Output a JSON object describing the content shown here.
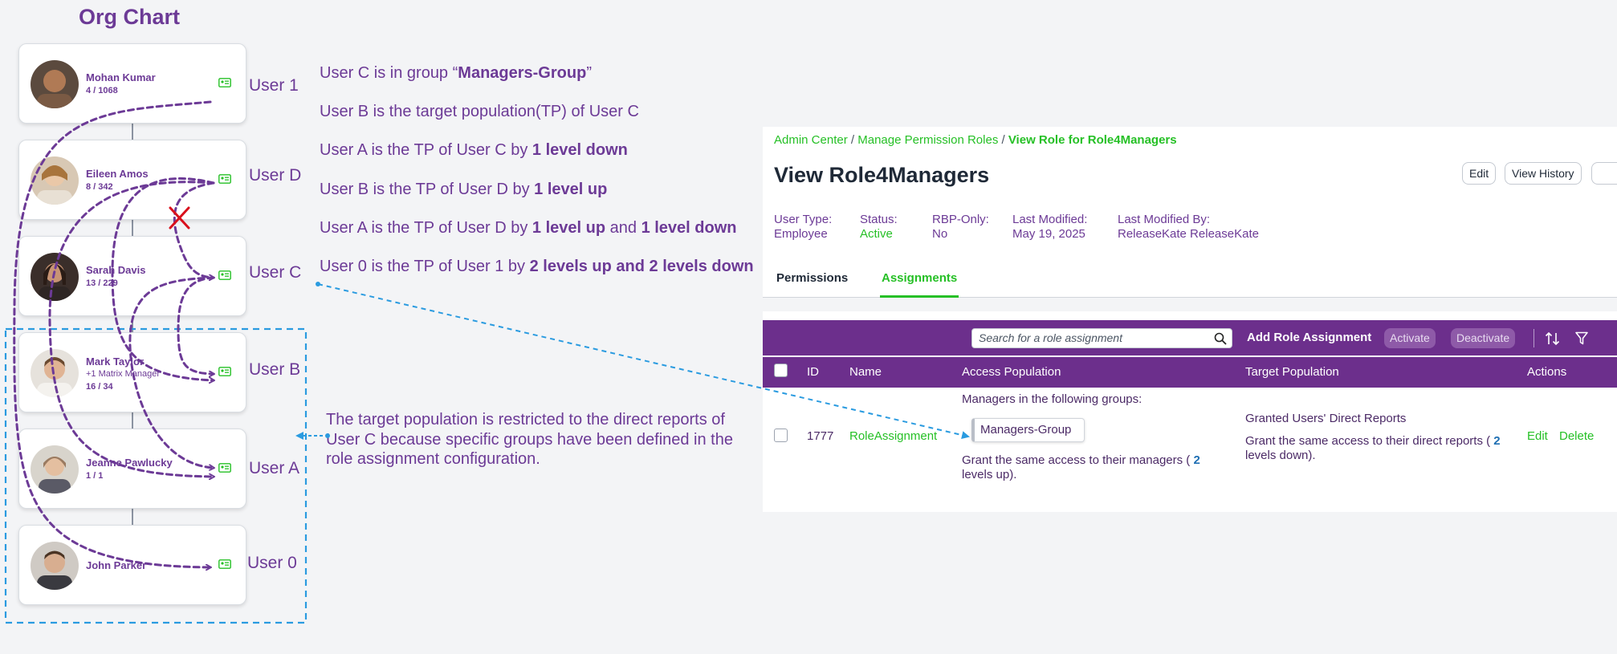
{
  "org_chart": {
    "title": "Org Chart",
    "cards": [
      {
        "name": "Mohan Kumar",
        "sub": "",
        "count": "4 / 1068",
        "user_label": "User 1"
      },
      {
        "name": "Eileen Amos",
        "sub": "",
        "count": "8 / 342",
        "user_label": "User D"
      },
      {
        "name": "Sarah Davis",
        "sub": "",
        "count": "13 / 229",
        "user_label": "User C"
      },
      {
        "name": "Mark Taylor",
        "sub": "+1 Matrix Manager",
        "count": "16 / 34",
        "user_label": "User B"
      },
      {
        "name": "Jeanne Pawlucky",
        "sub": "",
        "count": "1 / 1",
        "user_label": "User A"
      },
      {
        "name": "John Parker",
        "sub": "",
        "count": "",
        "user_label": "User 0"
      }
    ]
  },
  "statements": [
    {
      "parts": [
        {
          "t": "User C is in group “",
          "b": false
        },
        {
          "t": "Managers-Group",
          "b": true
        },
        {
          "t": "”",
          "b": false
        }
      ]
    },
    {
      "parts": [
        {
          "t": "User B is the target population(TP) of User C",
          "b": false
        }
      ]
    },
    {
      "parts": [
        {
          "t": "User A is the TP of User C by ",
          "b": false
        },
        {
          "t": "1 level down",
          "b": true
        }
      ]
    },
    {
      "parts": [
        {
          "t": "User B is the TP of User D by ",
          "b": false
        },
        {
          "t": "1 level up",
          "b": true
        }
      ]
    },
    {
      "parts": [
        {
          "t": "User A is the TP of User D by ",
          "b": false
        },
        {
          "t": "1 level up",
          "b": true
        },
        {
          "t": " and ",
          "b": false
        },
        {
          "t": "1 level down",
          "b": true
        }
      ]
    },
    {
      "parts": [
        {
          "t": "User 0 is the TP of User 1 by ",
          "b": false
        },
        {
          "t": "2 levels up and 2 levels down",
          "b": true
        }
      ]
    }
  ],
  "note": "The target population is restricted to the direct reports of User C because specific groups have been defined in the role assignment configuration.",
  "panel": {
    "breadcrumb": {
      "item1": "Admin Center",
      "item2": "Manage Permission Roles",
      "current": "View Role for Role4Managers",
      "sep": "/"
    },
    "title": "View Role4Managers",
    "buttons": {
      "edit": "Edit",
      "history": "View History"
    },
    "meta": [
      {
        "k": "User Type:",
        "v": "Employee"
      },
      {
        "k": "Status:",
        "v": "Active"
      },
      {
        "k": "RBP-Only:",
        "v": "No"
      },
      {
        "k": "Last Modified:",
        "v": "May 19, 2025"
      },
      {
        "k": "Last Modified By:",
        "v": "ReleaseKate ReleaseKate"
      }
    ],
    "tabs": {
      "permissions": "Permissions",
      "assignments": "Assignments"
    },
    "toolbar": {
      "search_placeholder": "Search for a role assignment",
      "add": "Add Role Assignment",
      "activate": "Activate",
      "deactivate": "Deactivate"
    },
    "columns": {
      "id": "ID",
      "name": "Name",
      "access": "Access Population",
      "target": "Target Population",
      "actions": "Actions"
    },
    "row": {
      "id": "1777",
      "name": "RoleAssignment",
      "access_heading": "Managers in the following groups:",
      "group_chip": "Managers-Group",
      "access_line1": "Grant the same access to their managers ( ",
      "access_num": "2",
      "access_line2": "levels up).",
      "target_heading": "Granted Users' Direct Reports",
      "target_line1": "Grant the same access to their direct reports ( ",
      "target_num": "2",
      "target_line2": "levels down).",
      "edit": "Edit",
      "delete": "Delete"
    }
  },
  "colors": {
    "purple": "#6c3a96",
    "header_purple": "#6c2f8c",
    "green": "#26c026",
    "blue_dash": "#2a9be0",
    "red_x": "#d9101c"
  }
}
